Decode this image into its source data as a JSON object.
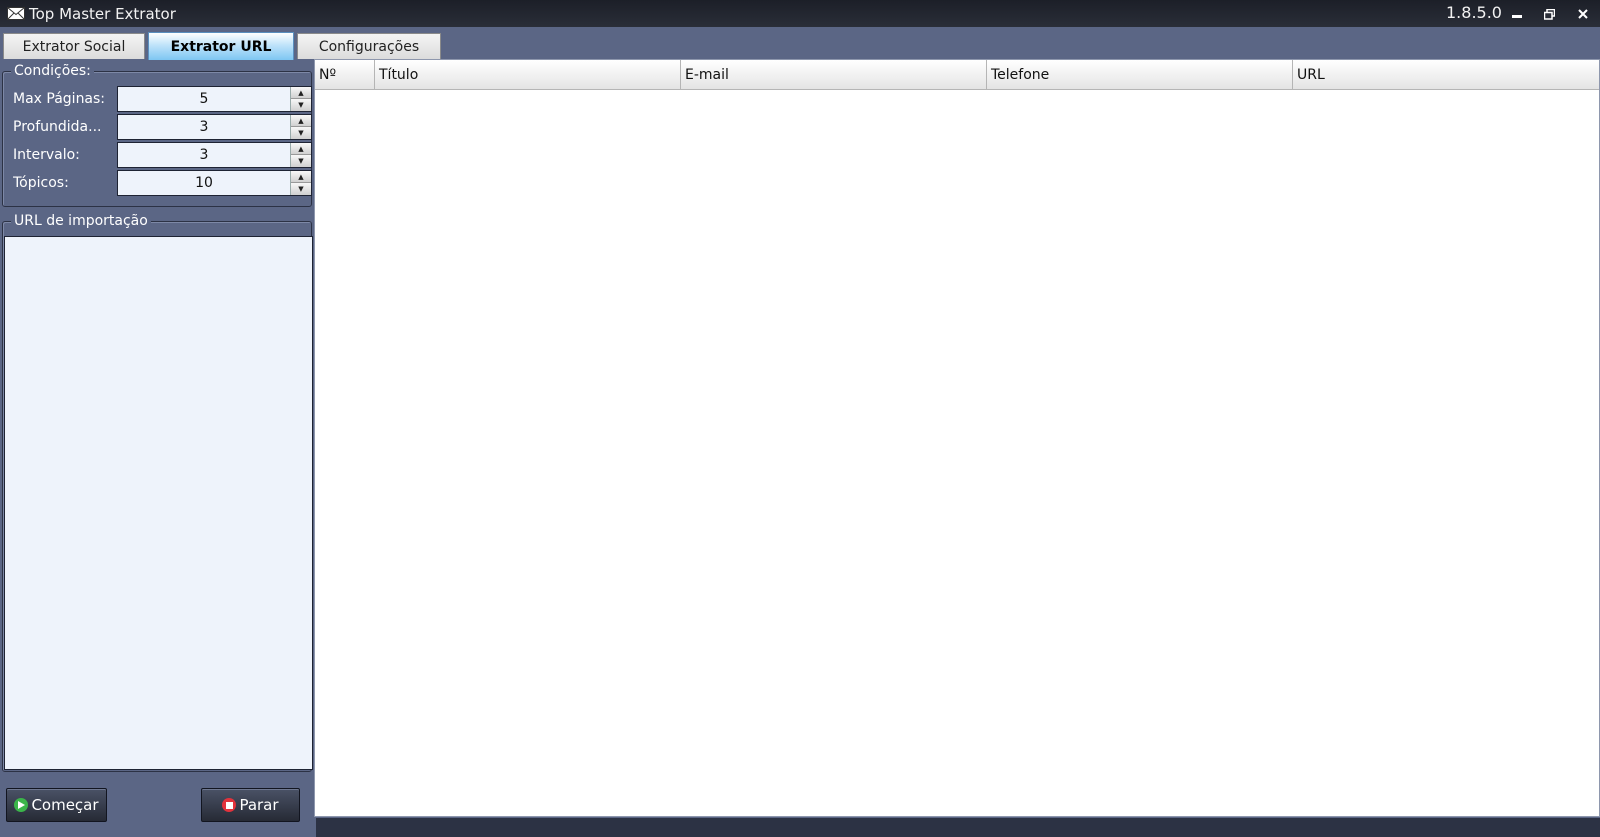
{
  "window": {
    "title": "Top Master Extrator",
    "version": "1.8.5.0",
    "app_icon": "envelope-icon",
    "controls": {
      "minimize": "minimize-icon",
      "restore": "restore-icon",
      "close": "close-icon"
    }
  },
  "tabs": [
    {
      "label": "Extrator Social",
      "active": false
    },
    {
      "label": "Extrator URL",
      "active": true
    },
    {
      "label": "Configurações",
      "active": false
    }
  ],
  "conditions": {
    "title": "Condições:",
    "fields": [
      {
        "label": "Max Páginas:",
        "value": "5"
      },
      {
        "label": "Profundida...",
        "value": "3"
      },
      {
        "label": "Intervalo:",
        "value": "3"
      },
      {
        "label": "Tópicos:",
        "value": "10"
      }
    ]
  },
  "import": {
    "title": "URL de importação",
    "value": ""
  },
  "buttons": {
    "start": "Começar",
    "stop": "Parar"
  },
  "grid": {
    "columns": [
      "Nº",
      "Título",
      "E-mail",
      "Telefone",
      "URL"
    ],
    "rows": []
  },
  "colors": {
    "background": "#5b6685",
    "titlebar": "#1c1f28",
    "start_icon": "#3bb54a",
    "stop_icon": "#e2323c"
  }
}
